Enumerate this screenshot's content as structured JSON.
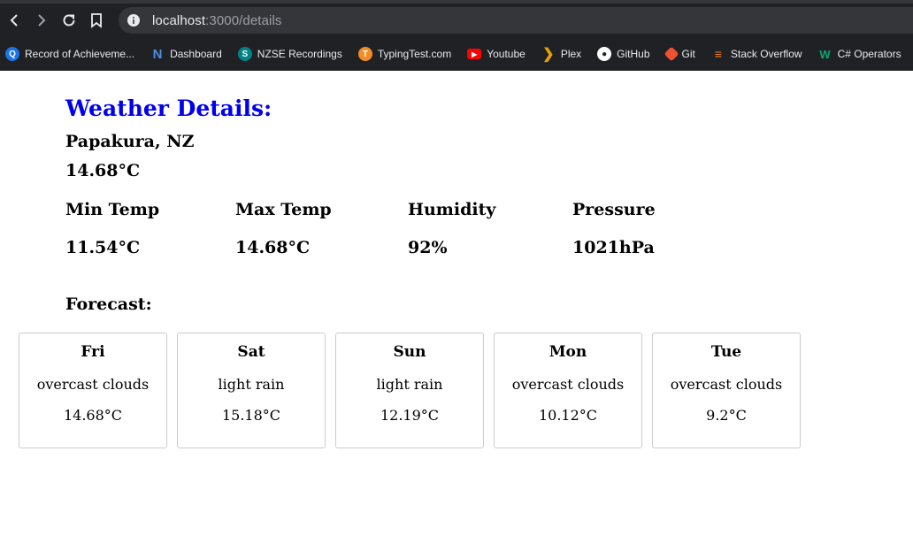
{
  "browser": {
    "url_host": "localhost",
    "url_path": ":3000/details",
    "bookmarks": [
      {
        "label": "Record of Achieveme...",
        "icon": "q-icon",
        "color": "#1a73e8"
      },
      {
        "label": "Dashboard",
        "icon": "n-icon",
        "color": "#4a90e2"
      },
      {
        "label": "NZSE Recordings",
        "icon": "sharepoint-icon",
        "color": "#038387"
      },
      {
        "label": "TypingTest.com",
        "icon": "typingtest-icon",
        "color": "#f28c28"
      },
      {
        "label": "Youtube",
        "icon": "youtube-icon",
        "color": "#ff0000"
      },
      {
        "label": "Plex",
        "icon": "plex-icon",
        "color": "#e5a00d"
      },
      {
        "label": "GitHub",
        "icon": "github-icon",
        "color": "#ffffff"
      },
      {
        "label": "Git",
        "icon": "git-icon",
        "color": "#f05133"
      },
      {
        "label": "Stack Overflow",
        "icon": "stackoverflow-icon",
        "color": "#f48024"
      },
      {
        "label": "C# Operators",
        "icon": "w3-icon",
        "color": "#04aa6d"
      }
    ]
  },
  "details": {
    "title": "Weather Details:",
    "city": "Papakura, NZ",
    "temp": "14.68°C",
    "stats": [
      {
        "label": "Min Temp",
        "value": "11.54°C"
      },
      {
        "label": "Max Temp",
        "value": "14.68°C"
      },
      {
        "label": "Humidity",
        "value": "92%"
      },
      {
        "label": "Pressure",
        "value": "1021hPa"
      }
    ]
  },
  "forecast": {
    "title": "Forecast:",
    "days": [
      {
        "day": "Fri",
        "desc": "overcast clouds",
        "temp": "14.68°C"
      },
      {
        "day": "Sat",
        "desc": "light rain",
        "temp": "15.18°C"
      },
      {
        "day": "Sun",
        "desc": "light rain",
        "temp": "12.19°C"
      },
      {
        "day": "Mon",
        "desc": "overcast clouds",
        "temp": "10.12°C"
      },
      {
        "day": "Tue",
        "desc": "overcast clouds",
        "temp": "9.2°C"
      }
    ]
  }
}
